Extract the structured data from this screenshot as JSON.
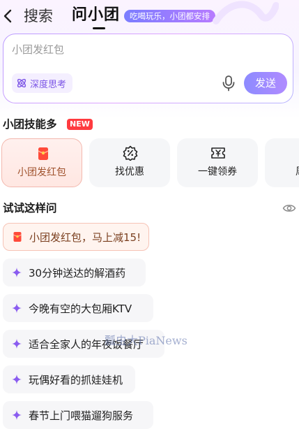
{
  "header": {
    "back_icon": "chevron-left-icon",
    "search_label": "搜索",
    "title": "问小团",
    "tagline": "吃喝玩乐，小团都安排"
  },
  "input": {
    "placeholder": "小团发红包",
    "value": "",
    "deep_think_label": "深度思考",
    "deep_think_icon": "atom-icon",
    "mic_icon": "microphone-icon",
    "send_label": "发送"
  },
  "skills": {
    "title": "小团技能多",
    "new_badge": "NEW",
    "items": [
      {
        "label": "小团发红包",
        "icon": "red-envelope-icon",
        "active": true
      },
      {
        "label": "找优惠",
        "icon": "discount-tag-icon",
        "active": false
      },
      {
        "label": "一键领券",
        "icon": "yuan-coupon-icon",
        "active": false
      },
      {
        "label": "周杰",
        "icon": "music-icon",
        "active": false
      }
    ]
  },
  "suggestions": {
    "title": "试试这样问",
    "refresh_icon": "eye-icon",
    "items": [
      {
        "text": "小团发红包，马上减15!",
        "icon": "red-envelope-icon",
        "hot": true
      },
      {
        "text": "30分钟送达的解酒药",
        "icon": "sparkle-icon",
        "hot": false
      },
      {
        "text": "今晚有空的大包厢KTV",
        "icon": "sparkle-icon",
        "hot": false
      },
      {
        "text": "适合全家人的年夜饭餐厅",
        "icon": "sparkle-icon",
        "hot": false
      },
      {
        "text": "玩偶好看的抓娃娃机",
        "icon": "sparkle-icon",
        "hot": false
      },
      {
        "text": "春节上门喂猫遛狗服务",
        "icon": "sparkle-icon",
        "hot": false
      }
    ]
  },
  "watermark": "瓢虫大PiaNews",
  "colors": {
    "accent": "#8d8bff",
    "sparkle": "#8a5cf0",
    "hot_border": "#f6c3b6",
    "new_badge": "#ff3b40"
  }
}
